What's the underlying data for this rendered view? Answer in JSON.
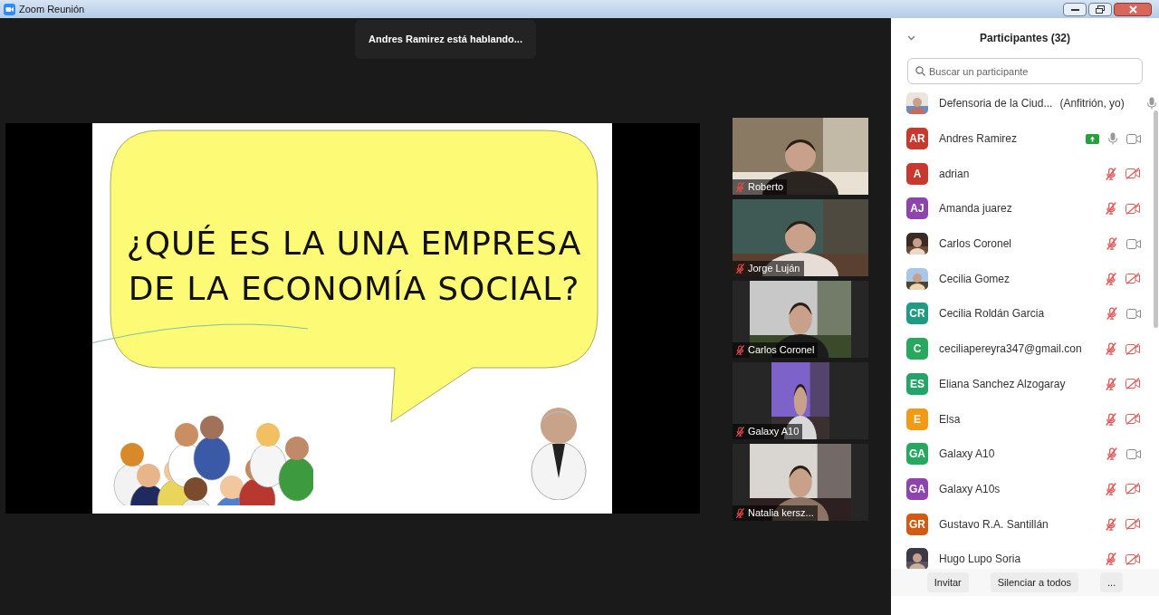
{
  "window": {
    "title": "Zoom Reunión"
  },
  "speaking_banner": "Andres Ramirez está hablando...",
  "slide": {
    "title_lines": [
      "¿QUÉ ES LA UNA EMPRESA",
      "DE LA ECONOMÍA SOCIAL?"
    ]
  },
  "video_tiles": [
    {
      "name": "Roberto",
      "muted": true
    },
    {
      "name": "Jorge Luján",
      "muted": true
    },
    {
      "name": "Carlos Coronel",
      "muted": true
    },
    {
      "name": "Galaxy A10",
      "muted": true
    },
    {
      "name": "Natalia kersz...",
      "muted": true
    }
  ],
  "participants_panel": {
    "title": "Participantes (32)",
    "search": {
      "placeholder": "Buscar un participante"
    },
    "participants": [
      {
        "name": "Defensoria de la Ciud...",
        "role": "(Anfitrión, yo)",
        "mic_muted": false
      },
      {
        "name": "Andres Ramirez",
        "avatar": {
          "kind": "initials",
          "initials": "AR",
          "color": "#c8382c"
        },
        "sharing": true,
        "mic_muted": false,
        "video_off": false
      },
      {
        "name": "adrian",
        "avatar": {
          "kind": "initials",
          "initials": "A",
          "color": "#c8382c"
        },
        "mic_muted": true,
        "video_off": true
      },
      {
        "name": "Amanda juarez",
        "avatar": {
          "kind": "initials",
          "initials": "AJ",
          "color": "#8e44ad"
        },
        "mic_muted": true,
        "video_off": true
      },
      {
        "name": "Carlos Coronel",
        "mic_muted": true,
        "video_off": false
      },
      {
        "name": "Cecilia Gomez",
        "mic_muted": true,
        "video_off": true
      },
      {
        "name": "Cecilia Roldán Garcia",
        "avatar": {
          "kind": "initials",
          "initials": "CR",
          "color": "#1e9b82"
        },
        "mic_muted": true,
        "video_off": false
      },
      {
        "name": "ceciliapereyra347@gmail.con",
        "avatar": {
          "kind": "initials",
          "initials": "C",
          "color": "#27a85e"
        },
        "mic_muted": true,
        "video_off": true
      },
      {
        "name": "Eliana Sanchez Alzogaray",
        "avatar": {
          "kind": "initials",
          "initials": "ES",
          "color": "#24a36a"
        },
        "mic_muted": true,
        "video_off": true
      },
      {
        "name": "Elsa",
        "avatar": {
          "kind": "initials",
          "initials": "E",
          "color": "#f29a16"
        },
        "mic_muted": true,
        "video_off": true
      },
      {
        "name": "Galaxy A10",
        "avatar": {
          "kind": "initials",
          "initials": "GA",
          "color": "#27a85e"
        },
        "mic_muted": true,
        "video_off": false
      },
      {
        "name": "Galaxy A10s",
        "avatar": {
          "kind": "initials",
          "initials": "GA",
          "color": "#8e44ad"
        },
        "mic_muted": true,
        "video_off": true
      },
      {
        "name": "Gustavo R.A. Santillán",
        "avatar": {
          "kind": "initials",
          "initials": "GR",
          "color": "#d35a10"
        },
        "mic_muted": true,
        "video_off": true
      },
      {
        "name": "Hugo Lupo Soria",
        "mic_muted": true,
        "video_off": true
      }
    ],
    "buttons": [
      "Invitar",
      "Silenciar a todos",
      "..."
    ]
  }
}
